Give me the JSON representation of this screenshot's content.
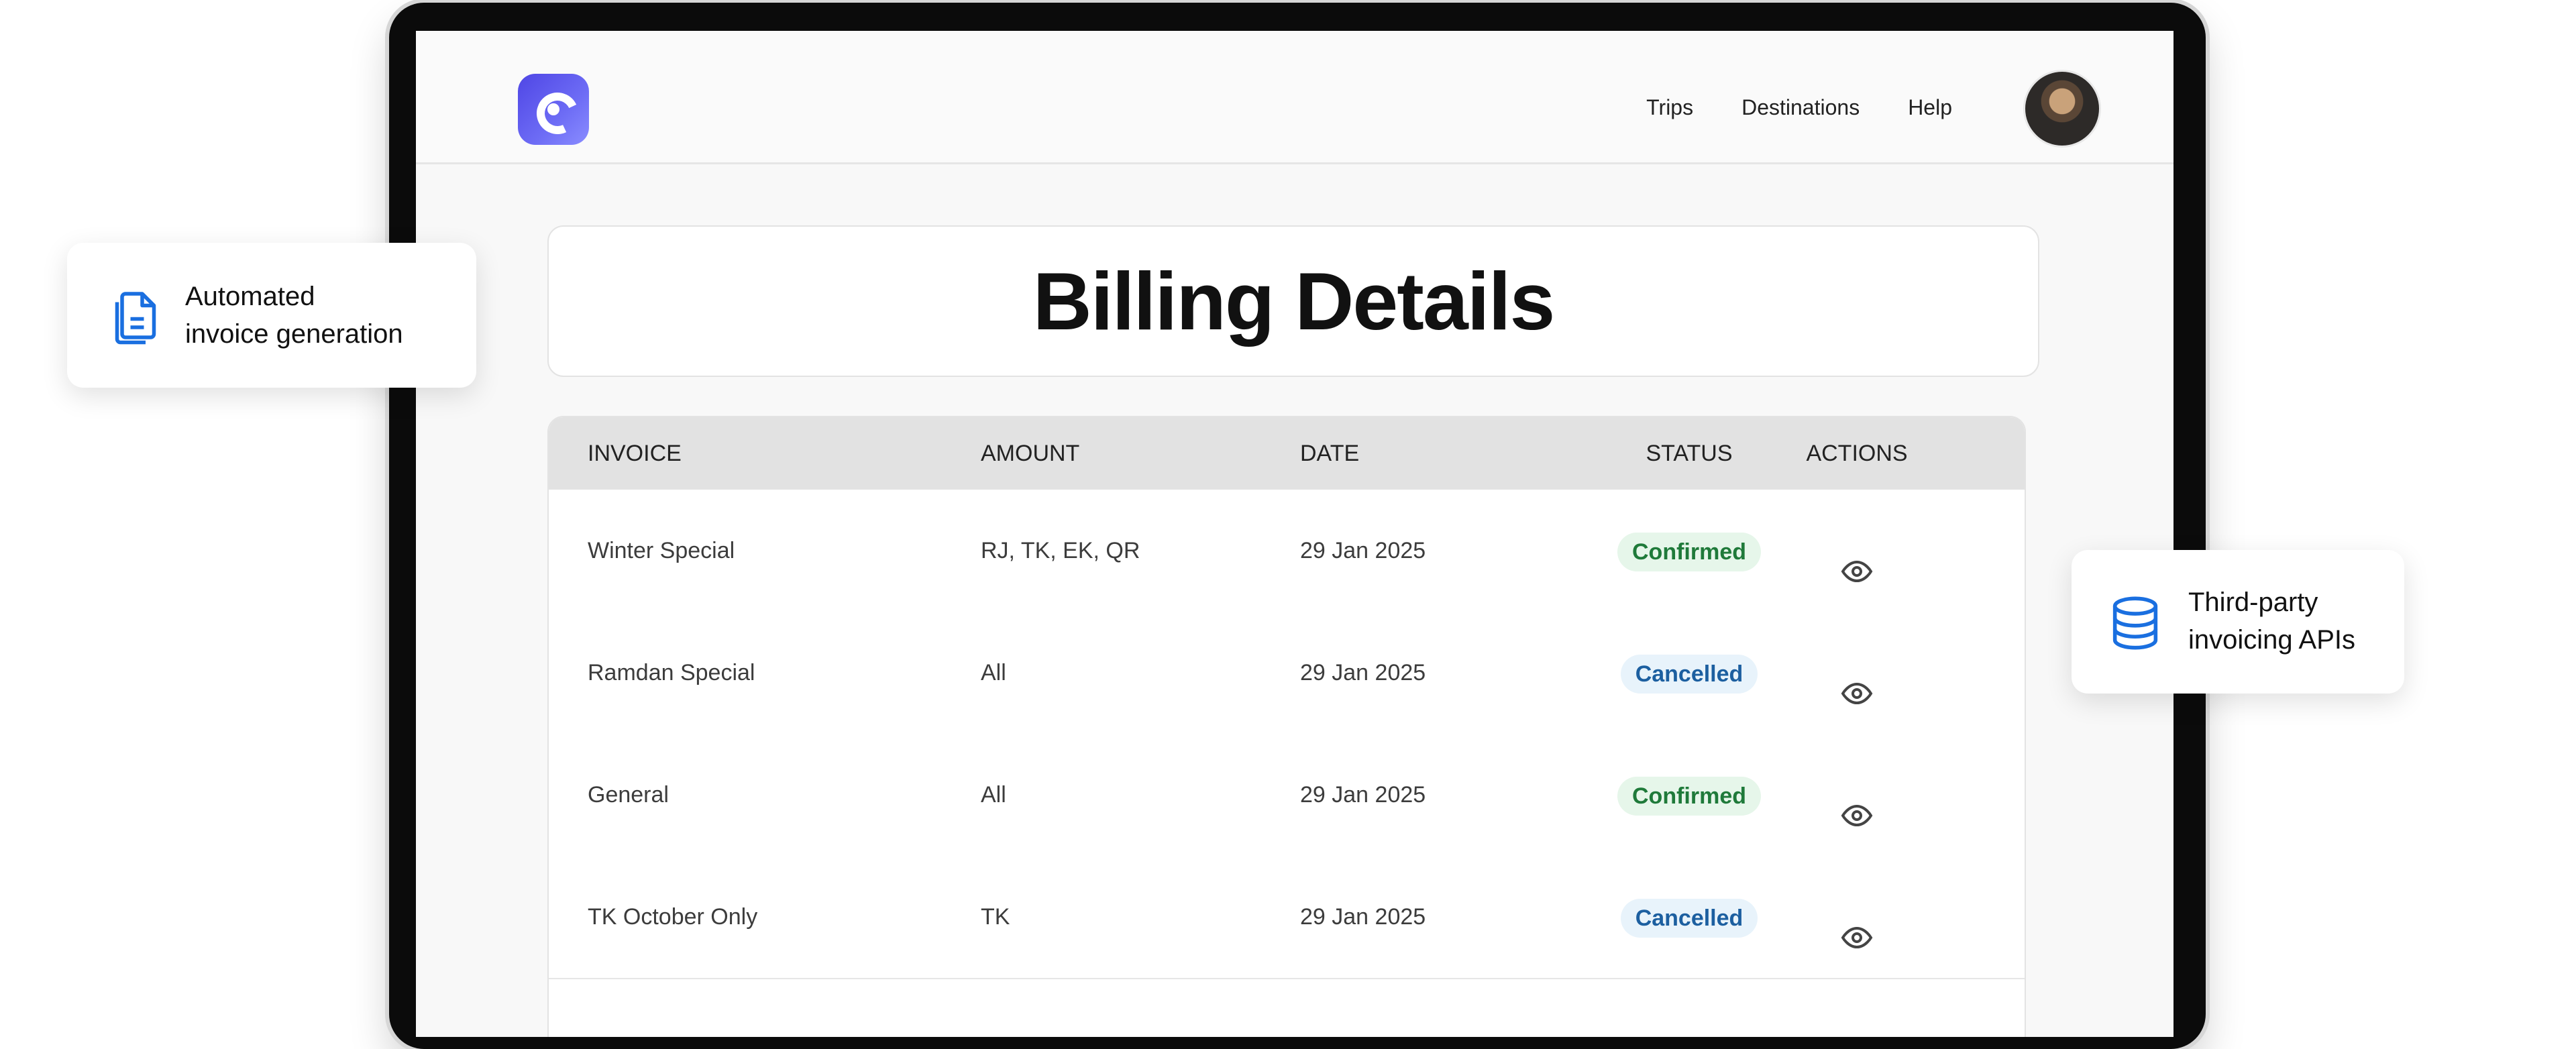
{
  "nav": {
    "links": [
      "Trips",
      "Destinations",
      "Help"
    ]
  },
  "page": {
    "title": "Billing Details"
  },
  "table": {
    "headers": {
      "invoice": "INVOICE",
      "amount": "AMOUNT",
      "date": "DATE",
      "status": "STATUS",
      "actions": "ACTIONS"
    },
    "rows": [
      {
        "invoice": "Winter Special",
        "amount": "RJ, TK, EK, QR",
        "date": "29 Jan 2025",
        "status": "Confirmed"
      },
      {
        "invoice": "Ramdan Special",
        "amount": "All",
        "date": "29 Jan 2025",
        "status": "Cancelled"
      },
      {
        "invoice": "General",
        "amount": "All",
        "date": "29 Jan 2025",
        "status": "Confirmed"
      },
      {
        "invoice": "TK October Only",
        "amount": "TK",
        "date": "29 Jan 2025",
        "status": "Cancelled"
      }
    ]
  },
  "features": {
    "left": {
      "line1": "Automated",
      "line2": "invoice generation",
      "icon": "document-icon"
    },
    "right": {
      "line1": "Third-party",
      "line2": "invoicing APIs",
      "icon": "database-icon"
    }
  },
  "colors": {
    "accent": "#4f46e5",
    "confirmed_text": "#1f7a3a",
    "confirmed_bg": "#e6f6ea",
    "cancelled_text": "#1c5fa0",
    "cancelled_bg": "#e8f3fb",
    "feature_icon": "#1a6fe0"
  }
}
